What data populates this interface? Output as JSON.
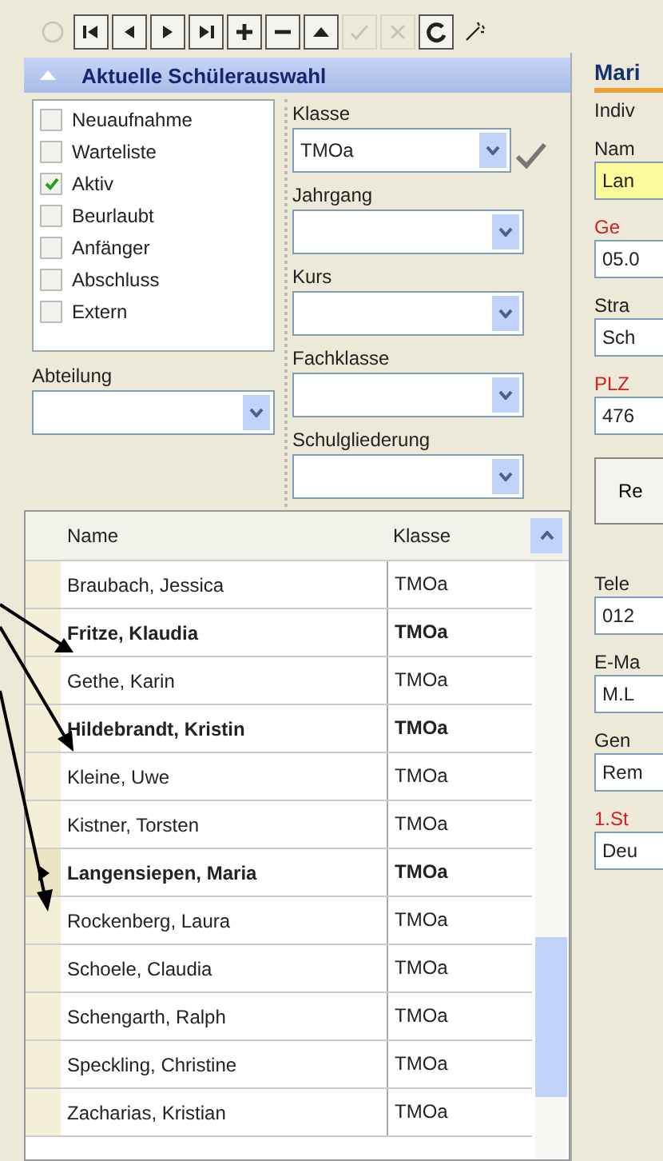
{
  "toolbar": [
    {
      "kind": "circle",
      "disabled": true
    },
    {
      "kind": "first",
      "disabled": false
    },
    {
      "kind": "prev",
      "disabled": false
    },
    {
      "kind": "next",
      "disabled": false
    },
    {
      "kind": "last",
      "disabled": false
    },
    {
      "kind": "add",
      "disabled": false
    },
    {
      "kind": "remove",
      "disabled": false
    },
    {
      "kind": "up",
      "disabled": false
    },
    {
      "kind": "confirm",
      "disabled": true
    },
    {
      "kind": "cancel",
      "disabled": true
    },
    {
      "kind": "refresh",
      "disabled": false
    },
    {
      "kind": "wand",
      "disabled": false
    }
  ],
  "selection_panel": {
    "title": "Aktuelle Schülerauswahl",
    "status_filters": [
      {
        "label": "Neuaufnahme",
        "checked": false
      },
      {
        "label": "Warteliste",
        "checked": false
      },
      {
        "label": "Aktiv",
        "checked": true
      },
      {
        "label": "Beurlaubt",
        "checked": false
      },
      {
        "label": "Anfänger",
        "checked": false
      },
      {
        "label": "Abschluss",
        "checked": false
      },
      {
        "label": "Extern",
        "checked": false
      }
    ],
    "abteilung": {
      "label": "Abteilung"
    },
    "fields": [
      {
        "label": "Klasse",
        "value": "TMOa",
        "confirm": true
      },
      {
        "label": "Jahrgang",
        "confirm": false
      },
      {
        "label": "Kurs",
        "confirm": false
      },
      {
        "label": "Fachklasse",
        "confirm": false
      },
      {
        "label": "Schulgliederung",
        "confirm": false
      }
    ]
  },
  "table": {
    "columns": [
      "Name",
      "Klasse"
    ],
    "rows": [
      {
        "name": "Braubach, Jessica",
        "klasse": "TMOa",
        "bold": false,
        "selected": false
      },
      {
        "name": "Fritze, Klaudia",
        "klasse": "TMOa",
        "bold": true,
        "selected": false
      },
      {
        "name": "Gethe, Karin",
        "klasse": "TMOa",
        "bold": false,
        "selected": false
      },
      {
        "name": "Hildebrandt, Kristin",
        "klasse": "TMOa",
        "bold": true,
        "selected": false
      },
      {
        "name": "Kleine, Uwe",
        "klasse": "TMOa",
        "bold": false,
        "selected": false
      },
      {
        "name": "Kistner, Torsten",
        "klasse": "TMOa",
        "bold": false,
        "selected": false
      },
      {
        "name": "Langensiepen, Maria",
        "klasse": "TMOa",
        "bold": true,
        "selected": true
      },
      {
        "name": "Rockenberg, Laura",
        "klasse": "TMOa",
        "bold": false,
        "selected": false
      },
      {
        "name": "Schoele, Claudia",
        "klasse": "TMOa",
        "bold": false,
        "selected": false
      },
      {
        "name": "Schengarth, Ralph",
        "klasse": "TMOa",
        "bold": false,
        "selected": false
      },
      {
        "name": "Speckling, Christine",
        "klasse": "TMOa",
        "bold": false,
        "selected": false
      },
      {
        "name": "Zacharias, Kristian",
        "klasse": "TMOa",
        "bold": false,
        "selected": false
      }
    ]
  },
  "detail_panel": {
    "tab_title": "Mari",
    "subtitle": "Indiv",
    "items": [
      {
        "kind": "field",
        "label": "Nam",
        "value": "Lan",
        "required": false,
        "highlighted": true
      },
      {
        "kind": "field",
        "label": "Ge",
        "value": "05.0",
        "required": true,
        "highlighted": false
      },
      {
        "kind": "field",
        "label": "Stra",
        "value": "Sch",
        "required": false,
        "highlighted": false
      },
      {
        "kind": "field",
        "label": "PLZ",
        "value": "476",
        "required": true,
        "highlighted": false
      },
      {
        "kind": "button",
        "label": "Re"
      },
      {
        "kind": "field",
        "label": "Tele",
        "value": "012",
        "required": false,
        "highlighted": false
      },
      {
        "kind": "field",
        "label": "E-Ma",
        "value": "M.L",
        "required": false,
        "highlighted": false
      },
      {
        "kind": "field",
        "label": "Gen",
        "value": "Rem",
        "required": false,
        "highlighted": false
      },
      {
        "kind": "field",
        "label": "1.St",
        "value": "Deu",
        "required": true,
        "highlighted": false
      }
    ]
  }
}
